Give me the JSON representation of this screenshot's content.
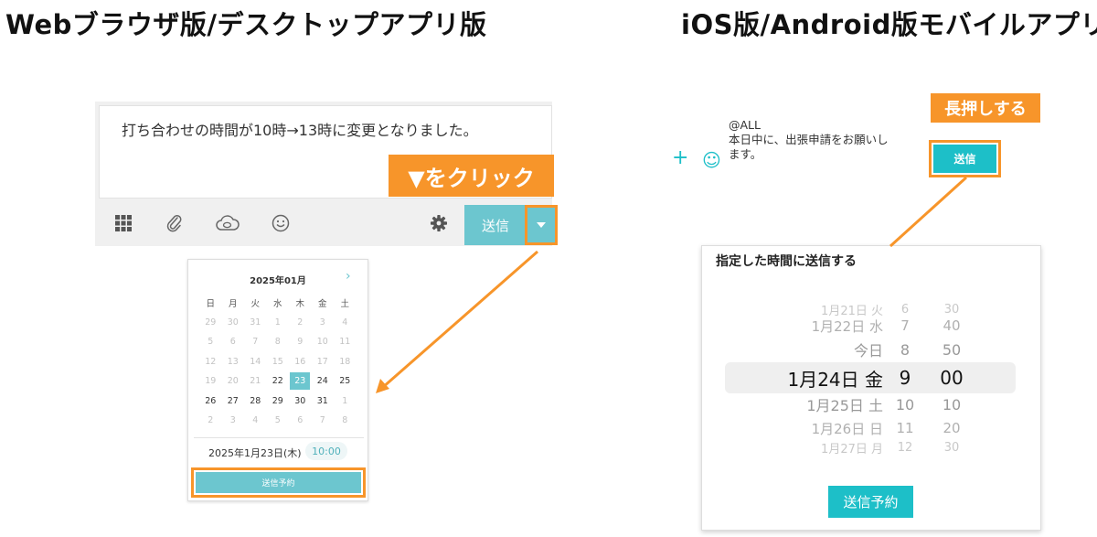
{
  "headings": {
    "left": "Webブラウザ版/デスクトップアプリ版",
    "right": "iOS版/Android版モバイルアプリ"
  },
  "colors": {
    "accent": "#f7952a",
    "teal": "#6cc6cf",
    "mobile_teal": "#1dbfc8"
  },
  "web": {
    "message": "打ち合わせの時間が10時→13時に変更となりました。",
    "callout": "▼をクリック",
    "toolbar": {
      "icons": [
        "grid-icon",
        "paperclip-icon",
        "cloud-icon",
        "smiley-icon",
        "gear-icon"
      ],
      "send_label": "送信"
    },
    "calendar": {
      "month_label": "2025年01月",
      "next_symbol": "›",
      "weekdays": [
        "日",
        "月",
        "火",
        "水",
        "木",
        "金",
        "土"
      ],
      "weeks": [
        [
          "29",
          "30",
          "31",
          "1",
          "2",
          "3",
          "4"
        ],
        [
          "5",
          "6",
          "7",
          "8",
          "9",
          "10",
          "11"
        ],
        [
          "12",
          "13",
          "14",
          "15",
          "16",
          "17",
          "18"
        ],
        [
          "19",
          "20",
          "21",
          "22",
          "23",
          "24",
          "25"
        ],
        [
          "26",
          "27",
          "28",
          "29",
          "30",
          "31",
          "1"
        ],
        [
          "2",
          "3",
          "4",
          "5",
          "6",
          "7",
          "8"
        ]
      ],
      "muted": [
        [
          true,
          true,
          true,
          true,
          true,
          true,
          true
        ],
        [
          true,
          true,
          true,
          true,
          true,
          true,
          true
        ],
        [
          true,
          true,
          true,
          true,
          true,
          true,
          true
        ],
        [
          true,
          true,
          true,
          false,
          false,
          false,
          false
        ],
        [
          false,
          false,
          false,
          false,
          false,
          false,
          true
        ],
        [
          true,
          true,
          true,
          true,
          true,
          true,
          true
        ]
      ],
      "selected": "23",
      "selected_date": "2025年1月23日(木)",
      "time": "10:00",
      "schedule_label": "送信予約"
    }
  },
  "mobile": {
    "callout": "長押しする",
    "plus_symbol": "+",
    "smile_symbol": "☺",
    "message_lines": [
      "@ALL",
      "本日中に、出張申請をお願いし",
      "ます。"
    ],
    "send_label": "送信",
    "picker": {
      "title": "指定した時間に送信する",
      "rows": [
        {
          "date": "1月21日 火",
          "hour": "6",
          "min": "30"
        },
        {
          "date": "1月22日 水",
          "hour": "7",
          "min": "40"
        },
        {
          "date": "今日",
          "hour": "8",
          "min": "50"
        },
        {
          "date": "1月24日 金",
          "hour": "9",
          "min": "00"
        },
        {
          "date": "1月25日 土",
          "hour": "10",
          "min": "10"
        },
        {
          "date": "1月26日 日",
          "hour": "11",
          "min": "20"
        },
        {
          "date": "1月27日 月",
          "hour": "12",
          "min": "30"
        }
      ],
      "schedule_label": "送信予約"
    }
  }
}
